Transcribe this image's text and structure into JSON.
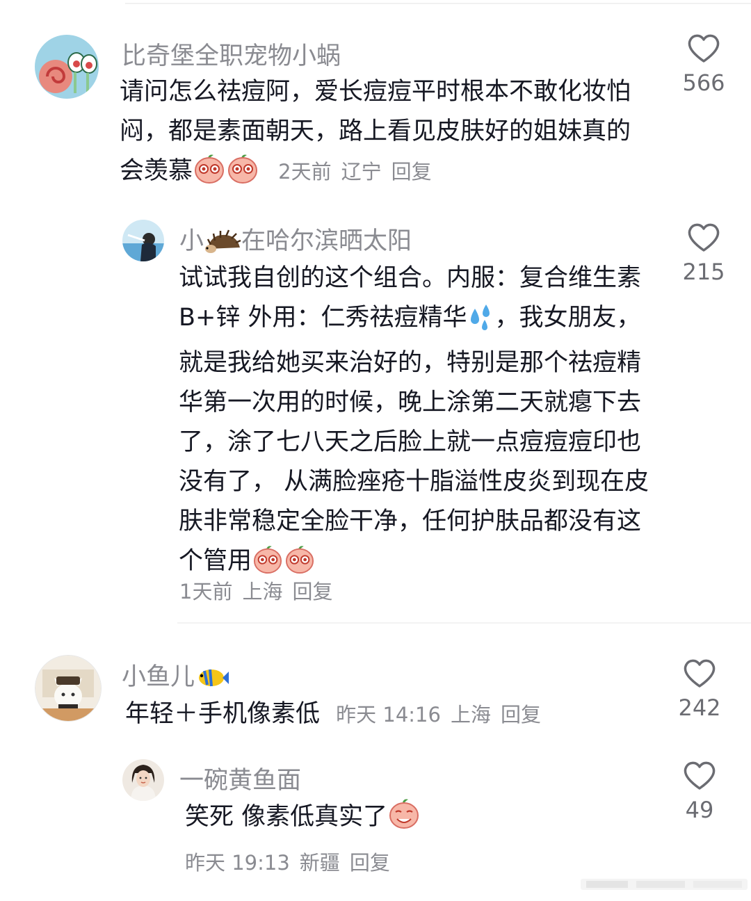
{
  "comments": [
    {
      "username": "比奇堡全职宠物小蜗",
      "text": "请问怎么祛痘阿，爱长痘痘平时根本不敢化妆怕闷，都是素面朝天，路上看见皮肤好的姐妹真的会羡慕",
      "time": "2天前",
      "location": "辽宁",
      "reply_label": "回复",
      "likes": "566",
      "reply": {
        "username_prefix": "小",
        "username_suffix": "在哈尔滨晒太阳",
        "text": "试试我自创的这个组合。内服：复合维生素B+锌 外用：仁秀祛痘精华",
        "text_rest": "，我女朋友，就是我给她买来治好的，特别是那个祛痘精华第一次用的时候，晚上涂第二天就瘪下去了，涂了七八天之后脸上就一点痘痘痘印也没有了， 从满脸痤疮十脂溢性皮炎到现在皮肤非常稳定全脸干净，任何护肤品都没有这个管用",
        "time": "1天前",
        "location": "上海",
        "reply_label": "回复",
        "likes": "215"
      }
    },
    {
      "username": "小鱼儿",
      "text": "年轻＋手机像素低",
      "time": "昨天 14:16",
      "location": "上海",
      "reply_label": "回复",
      "likes": "242",
      "reply": {
        "username": "一碗黄鱼面",
        "text": "笑死 像素低真实了",
        "time": "昨天 19:13",
        "location": "新疆",
        "reply_label": "回复",
        "likes": "49"
      }
    }
  ],
  "colors": {
    "text": "#161823",
    "secondary": "#8a8b91",
    "count": "#6b6c72"
  },
  "icons": [
    "heart-icon",
    "peach-emoji",
    "sweat-drops-emoji",
    "hedgehog-emoji",
    "tropical-fish-emoji"
  ]
}
